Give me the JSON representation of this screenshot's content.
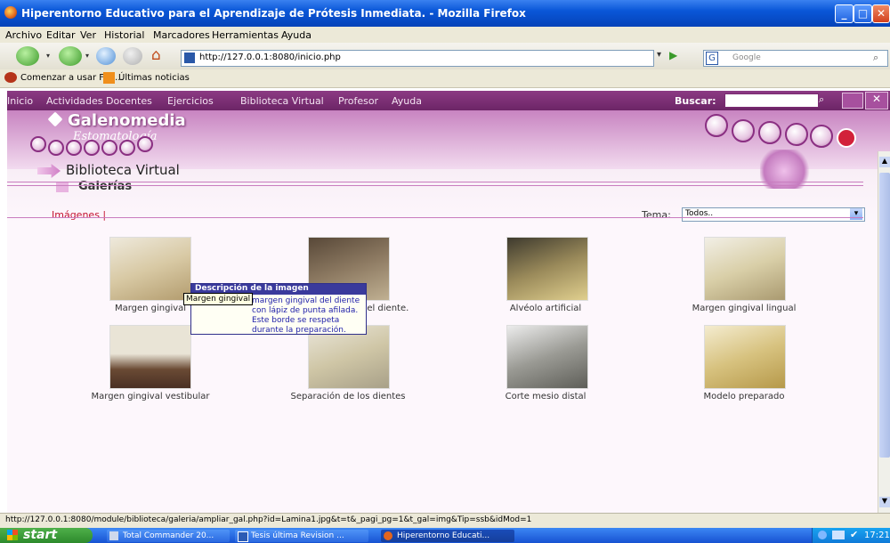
{
  "window": {
    "title": "Hiperentorno Educativo para el Aprendizaje de Prótesis Inmediata. - Mozilla Firefox"
  },
  "menubar": {
    "items": [
      "Archivo",
      "Editar",
      "Ver",
      "Historial",
      "Marcadores",
      "Herramientas",
      "Ayuda"
    ]
  },
  "navbar": {
    "url": "http://127.0.0.1:8080/inicio.php",
    "search_placeholder": "Google"
  },
  "bookmarks": {
    "items": [
      "Comenzar a usar Fire...",
      "Últimas noticias"
    ]
  },
  "site": {
    "nav": [
      "Inicio",
      "Actividades Docentes",
      "Ejercicios",
      "Biblioteca Virtual",
      "Profesor",
      "Ayuda"
    ],
    "search_label": "Buscar:",
    "logo_main": "Galenomedia",
    "logo_sub": "Estomatología"
  },
  "page": {
    "section_title": "Biblioteca Virtual",
    "subsection_title": "Galerías",
    "tab_images": "Imágenes |",
    "tema_label": "Tema:",
    "tema_value": "Todos.."
  },
  "gallery": [
    {
      "caption": "Margen gingival",
      "color": "#d8c9a4"
    },
    {
      "caption": "Margen gingival del diente.",
      "color": "#8d7a62"
    },
    {
      "caption": "Alvéolo artificial",
      "color": "#9a8a5a"
    },
    {
      "caption": "Margen gingival lingual",
      "color": "#d9cfa8"
    },
    {
      "caption": "Margen gingival vestibular",
      "color": "#9b8f79"
    },
    {
      "caption": "Separación de los dientes",
      "color": "#cfc6a6"
    },
    {
      "caption": "Corte mesio distal",
      "color": "#9a9a94"
    },
    {
      "caption": "Modelo preparado",
      "color": "#d7c27f"
    }
  ],
  "tooltip": {
    "small": "Margen gingival",
    "title": "Descripción de la imagen",
    "body": "margen gingival del diente con lápiz de punta afilada. Este borde se respeta durante la preparación."
  },
  "statusbar": {
    "text": "http://127.0.0.1:8080/module/biblioteca/galeria/ampliar_gal.php?id=Lamina1.jpg&t=t&_pagi_pg=1&t_gal=img&Tip=ssb&idMod=1"
  },
  "taskbar": {
    "start": "start",
    "tasks": [
      "Total Commander 20...",
      "Tesis última Revision ...",
      "Hiperentorno Educati..."
    ],
    "clock": "17:21"
  }
}
